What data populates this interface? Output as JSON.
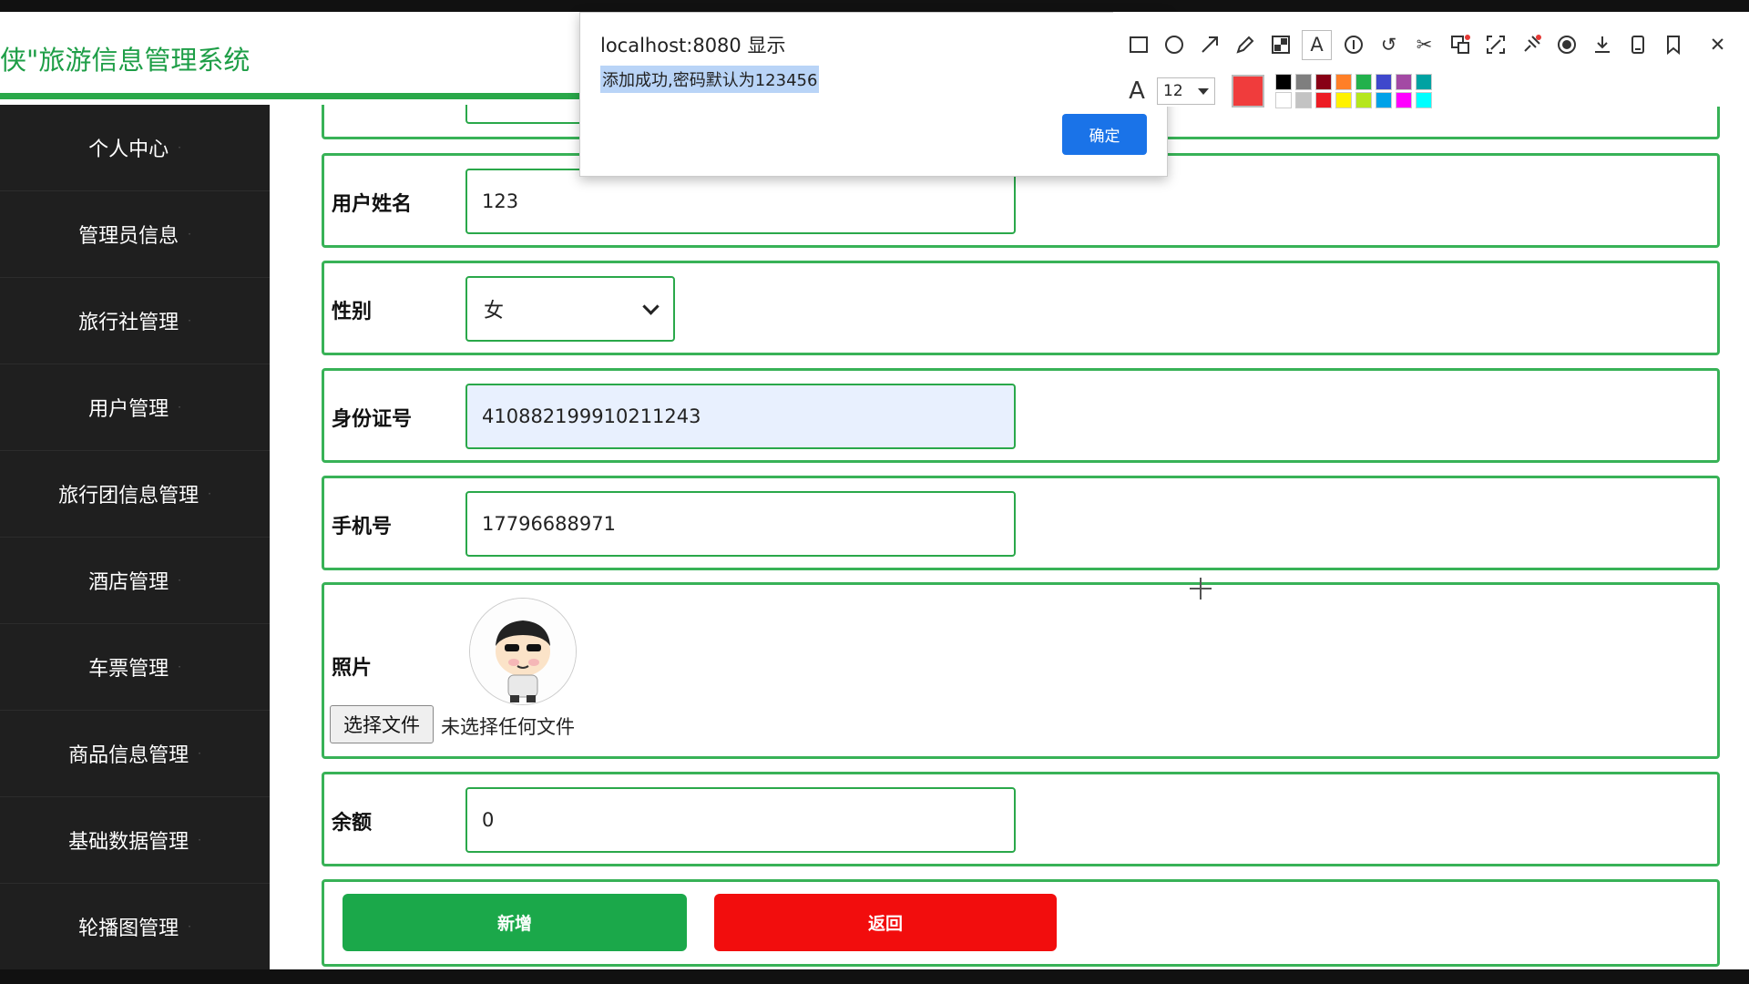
{
  "app": {
    "title": "侠\"旅游信息管理系统"
  },
  "sidebar": {
    "items": [
      {
        "label": "个人中心"
      },
      {
        "label": "管理员信息"
      },
      {
        "label": "旅行社管理"
      },
      {
        "label": "用户管理"
      },
      {
        "label": "旅行团信息管理"
      },
      {
        "label": "酒店管理"
      },
      {
        "label": "车票管理"
      },
      {
        "label": "商品信息管理"
      },
      {
        "label": "基础数据管理"
      },
      {
        "label": "轮播图管理"
      }
    ]
  },
  "form": {
    "username_label": "用户姓名",
    "username_value": "123",
    "gender_label": "性别",
    "gender_value": "女",
    "idcard_label": "身份证号",
    "idcard_value": "410882199910211243",
    "phone_label": "手机号",
    "phone_value": "17796688971",
    "photo_label": "照片",
    "file_button": "选择文件",
    "file_status": "未选择任何文件",
    "balance_label": "余额",
    "balance_value": "0",
    "add_button": "新增",
    "back_button": "返回"
  },
  "dialog": {
    "title": "localhost:8080 显示",
    "message": "添加成功,密码默认为123456",
    "ok_label": "确定"
  },
  "annotation_toolbar": {
    "font_size": "12",
    "current_color": "#f03c3c",
    "swatches": [
      "#000000",
      "#7f7f7f",
      "#880015",
      "#ff7f27",
      "#22b14c",
      "#3f48cc",
      "#a349a4",
      "#00a2a2",
      "#ffffff",
      "#c3c3c3",
      "#ed1c24",
      "#fff200",
      "#b5e61d",
      "#00a2e8",
      "#ff00ff",
      "#00ffff"
    ],
    "icons": [
      "rectangle-icon",
      "circle-icon",
      "arrow-icon",
      "pencil-icon",
      "mosaic-icon",
      "text-icon",
      "number-icon",
      "undo-icon",
      "cut-icon",
      "translate-icon",
      "ocr-icon",
      "pin-icon",
      "record-icon",
      "download-icon",
      "save-icon",
      "bookmark-icon",
      "close-icon"
    ]
  },
  "colors": {
    "accent": "#2aa84a",
    "sidebar_bg": "#1f1f1f",
    "danger": "#f20d0d",
    "primary": "#1a73e8"
  }
}
